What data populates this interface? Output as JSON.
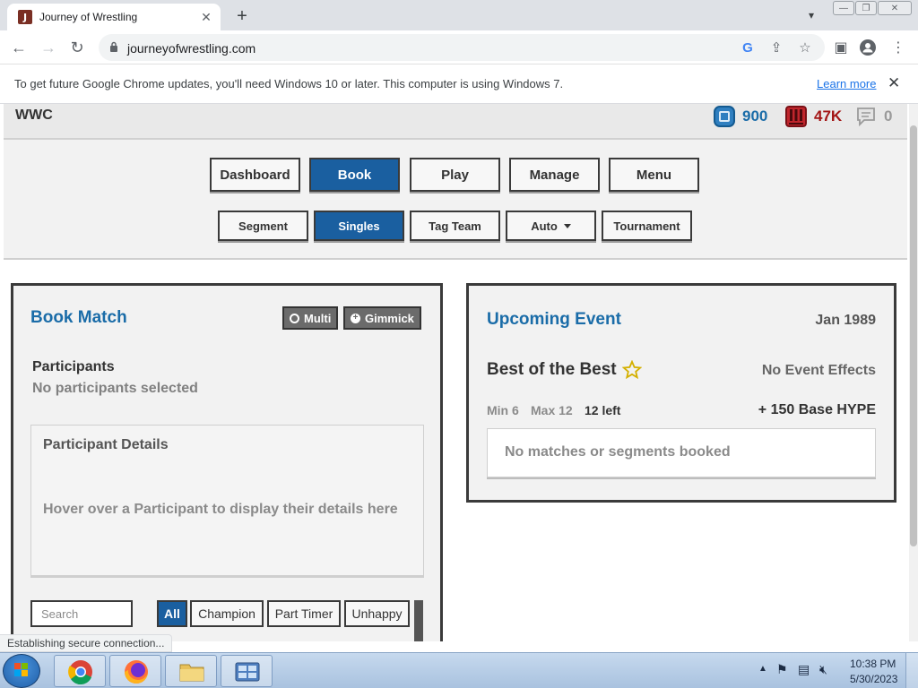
{
  "browser": {
    "tab_title": "Journey of Wrestling",
    "favicon_letter": "J",
    "url": "journeyofwrestling.com"
  },
  "infobar": {
    "message": "To get future Google Chrome updates, you'll need Windows 10 or later. This computer is using Windows 7.",
    "link_label": "Learn more"
  },
  "header": {
    "brand": "WWC",
    "stats": {
      "points": "900",
      "hype": "47K",
      "messages": "0"
    },
    "colors": {
      "points": "#1a6ca8",
      "hype": "#a31515",
      "messages": "#9a9a9a"
    }
  },
  "nav": {
    "primary": [
      "Dashboard",
      "Book",
      "Play",
      "Manage",
      "Menu"
    ],
    "primary_active": "Book",
    "secondary": [
      "Segment",
      "Singles",
      "Tag Team",
      "Auto",
      "Tournament"
    ],
    "secondary_active": "Singles"
  },
  "book_match": {
    "title": "Book Match",
    "multi_label": "Multi",
    "gimmick_label": "Gimmick",
    "participants_label": "Participants",
    "participants_empty": "No participants selected",
    "details_title": "Participant Details",
    "details_hint": "Hover over a Participant to display their details here",
    "search_placeholder": "Search",
    "filters": [
      "All",
      "Champion",
      "Part Timer",
      "Unhappy"
    ],
    "active_filter": "All"
  },
  "upcoming_event": {
    "title": "Upcoming Event",
    "date": "Jan 1989",
    "event_name": "Best of the Best",
    "effects": "No Event Effects",
    "min": "Min 6",
    "max": "Max 12",
    "left": "12 left",
    "hype": "+ 150 Base HYPE",
    "booked_empty": "No matches or segments booked"
  },
  "status": {
    "text": "Establishing secure connection..."
  },
  "taskbar": {
    "time": "10:38 PM",
    "date": "5/30/2023"
  },
  "accent_color": "#1a5fa0"
}
